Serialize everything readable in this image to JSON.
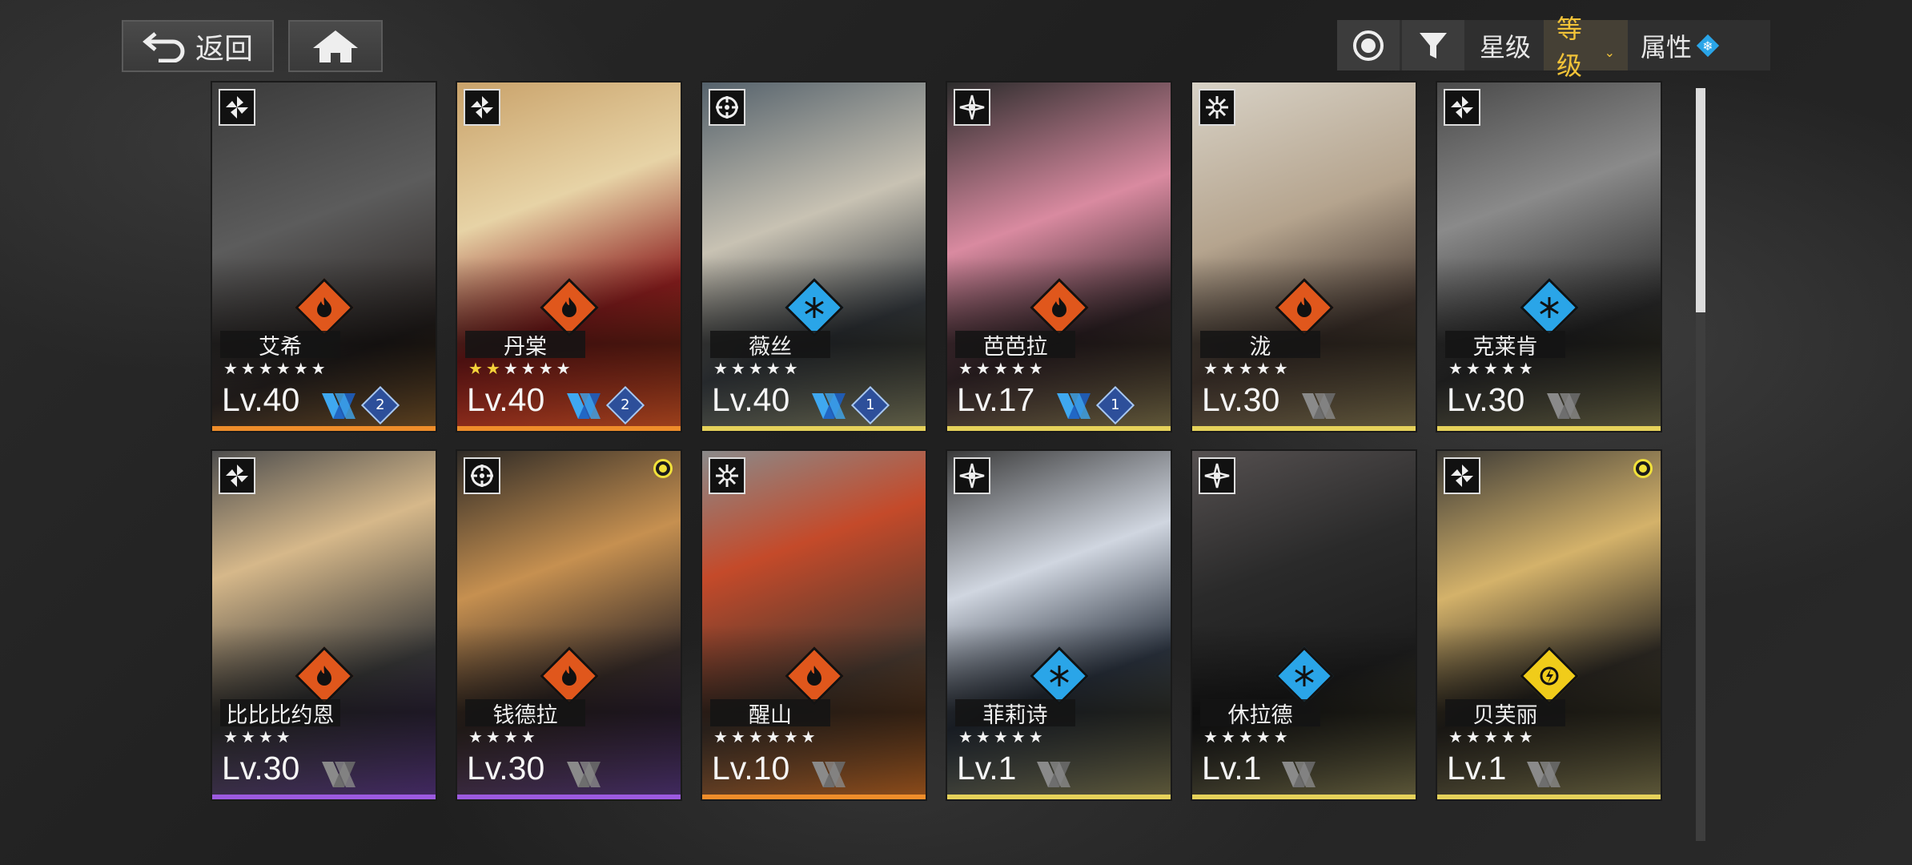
{
  "header": {
    "back_label": "返回",
    "home_icon": "home-icon"
  },
  "toolbar": {
    "view_icon": "radio-target-icon",
    "filter_icon": "filter-icon",
    "star_label": "星级",
    "level_label": "等级",
    "attribute_label": "属性",
    "active_sort": "等级"
  },
  "colors": {
    "fire": "#e0571c",
    "ice": "#2aa5e8",
    "electric": "#f0cc1a",
    "gold": "#f2c338",
    "purple": "#8c4fd6",
    "orange": "#ef8d2a"
  },
  "characters": [
    {
      "name": "艾希",
      "class_icon": "pinwheel-icon",
      "element": "fire",
      "stars": "★★★★★★",
      "gold_stars": "",
      "level": "Lv.40",
      "weapon_tier": "2",
      "rarity": "orange"
    },
    {
      "name": "丹棠",
      "class_icon": "pinwheel-icon",
      "element": "fire",
      "stars": "★★★★",
      "gold_stars": "★★",
      "level": "Lv.40",
      "weapon_tier": "2",
      "rarity": "orange"
    },
    {
      "name": "薇丝",
      "class_icon": "crosshair-icon",
      "element": "ice",
      "stars": "★★★★★",
      "gold_stars": "",
      "level": "Lv.40",
      "weapon_tier": "1",
      "rarity": "gold"
    },
    {
      "name": "芭芭拉",
      "class_icon": "sparkle-icon",
      "element": "fire",
      "stars": "★★★★★",
      "gold_stars": "",
      "level": "Lv.17",
      "weapon_tier": "1",
      "rarity": "gold"
    },
    {
      "name": "泷",
      "class_icon": "snowburst-icon",
      "element": "fire",
      "stars": "★★★★★",
      "gold_stars": "",
      "level": "Lv.30",
      "weapon_tier": "",
      "rarity": "gold"
    },
    {
      "name": "克莱肯",
      "class_icon": "pinwheel-icon",
      "element": "ice",
      "stars": "★★★★★",
      "gold_stars": "",
      "level": "Lv.30",
      "weapon_tier": "",
      "rarity": "gold"
    },
    {
      "name": "比比比约恩",
      "class_icon": "pinwheel-icon",
      "element": "fire",
      "stars": "★★★★",
      "gold_stars": "",
      "level": "Lv.30",
      "weapon_tier": "",
      "rarity": "purple"
    },
    {
      "name": "钱德拉",
      "class_icon": "crosshair-icon",
      "element": "fire",
      "stars": "★★★★",
      "gold_stars": "",
      "level": "Lv.30",
      "weapon_tier": "",
      "rarity": "purple"
    },
    {
      "name": "醒山",
      "class_icon": "snowburst-icon",
      "element": "fire",
      "stars": "★★★★★★",
      "gold_stars": "",
      "level": "Lv.10",
      "weapon_tier": "",
      "rarity": "orange"
    },
    {
      "name": "菲莉诗",
      "class_icon": "sparkle-icon",
      "element": "ice",
      "stars": "★★★★★",
      "gold_stars": "",
      "level": "Lv.1",
      "weapon_tier": "",
      "rarity": "gold"
    },
    {
      "name": "休拉德",
      "class_icon": "sparkle-icon",
      "element": "ice",
      "stars": "★★★★★",
      "gold_stars": "",
      "level": "Lv.1",
      "weapon_tier": "",
      "rarity": "gold"
    },
    {
      "name": "贝芙丽",
      "class_icon": "pinwheel-icon",
      "element": "electric",
      "stars": "★★★★★",
      "gold_stars": "",
      "level": "Lv.1",
      "weapon_tier": "",
      "rarity": "gold"
    }
  ]
}
